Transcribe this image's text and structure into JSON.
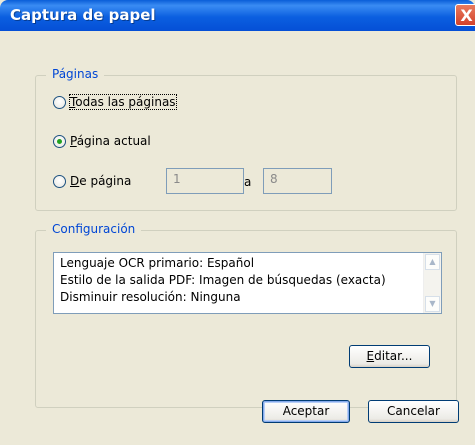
{
  "window": {
    "title": "Captura de papel",
    "close_glyph": "X"
  },
  "pages_group": {
    "legend": "Páginas",
    "options": [
      {
        "mnemonic": "T",
        "rest": "odas las páginas",
        "selected": false
      },
      {
        "mnemonic": "P",
        "rest": "ágina actual",
        "selected": true
      },
      {
        "mnemonic": "D",
        "rest": "e página",
        "selected": false
      }
    ],
    "from_value": "1",
    "to_label": "a",
    "to_value": "8"
  },
  "config_group": {
    "legend": "Configuración",
    "lines": [
      "Lenguaje OCR primario: Español",
      "Estilo de la salida PDF: Imagen de búsquedas (exacta)",
      "Disminuir resolución: Ninguna"
    ],
    "edit_mnemonic": "E",
    "edit_rest": "ditar..."
  },
  "buttons": {
    "ok": "Aceptar",
    "cancel": "Cancelar"
  },
  "colors": {
    "titlebar": "#0a5ed8",
    "legend": "#0046d5",
    "dialog_bg": "#ece9d8"
  }
}
